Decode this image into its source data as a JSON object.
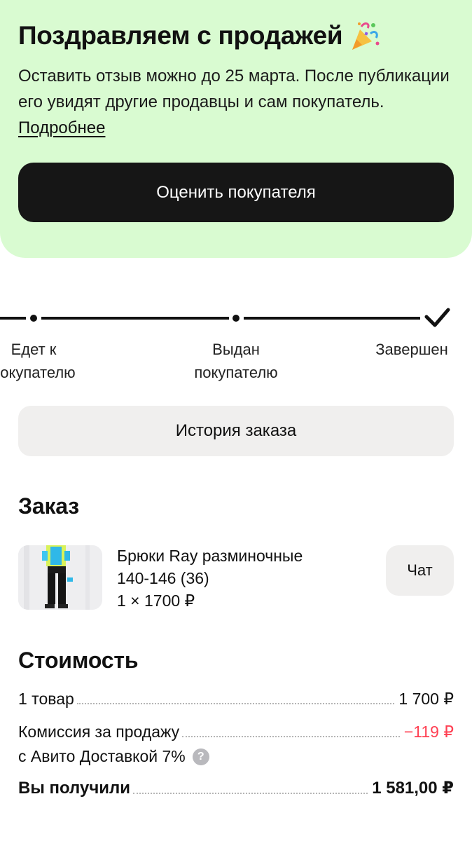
{
  "banner": {
    "title": "Поздравляем с продажей",
    "icon": "party-popper-icon",
    "text": "Оставить отзыв можно до 25 марта. После публикации его увидят другие продавцы и сам покупатель. ",
    "link": "Подробнее",
    "rate_button": "Оценить покупателя",
    "background": "#d9fbd1"
  },
  "progress": {
    "steps": [
      {
        "label_line1": "Едет к",
        "label_line2": "покупателю"
      },
      {
        "label_line1": "Выдан",
        "label_line2": "покупателю"
      },
      {
        "label_line1": "Завершен",
        "label_line2": ""
      }
    ]
  },
  "history_button": "История заказа",
  "order": {
    "title": "Заказ",
    "item_name": "Брюки Ray разминочные",
    "item_size": "140-146 (36)",
    "item_qty_price": "1 × 1700 ₽",
    "chat_button": "Чат"
  },
  "cost": {
    "title": "Стоимость",
    "rows": [
      {
        "label": "1 товар",
        "value": "1 700 ₽"
      },
      {
        "label": "Комиссия за продажу",
        "value": "−119 ₽",
        "sub_label": "с Авито Доставкой 7%"
      },
      {
        "label": "Вы получили",
        "value": "1 581,00 ₽"
      }
    ],
    "help_symbol": "?",
    "negative_color": "#ff4053"
  }
}
